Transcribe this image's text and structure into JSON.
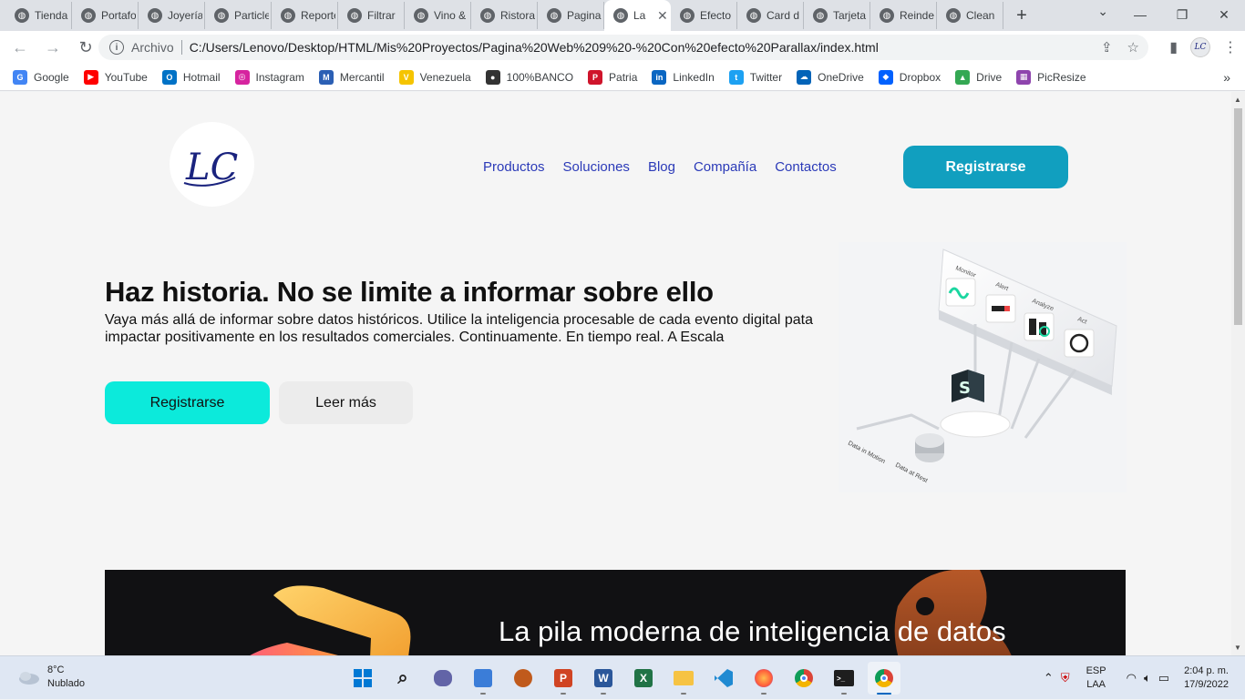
{
  "browser": {
    "tabs": [
      {
        "label": "Tienda",
        "active": false
      },
      {
        "label": "Portafolio",
        "active": false
      },
      {
        "label": "Joyería",
        "active": false
      },
      {
        "label": "Particles",
        "active": false
      },
      {
        "label": "Reportes",
        "active": false
      },
      {
        "label": "Filtrar",
        "active": false
      },
      {
        "label": "Vino &",
        "active": false
      },
      {
        "label": "Ristorante",
        "active": false
      },
      {
        "label": "Pagina",
        "active": false
      },
      {
        "label": "La",
        "active": true
      },
      {
        "label": "Efecto",
        "active": false
      },
      {
        "label": "Card d",
        "active": false
      },
      {
        "label": "Tarjeta",
        "active": false
      },
      {
        "label": "Reindeer",
        "active": false
      },
      {
        "label": "Clean",
        "active": false
      }
    ],
    "new_tab_label": "+",
    "address": {
      "scheme_label": "Archivo",
      "url": "C:/Users/Lenovo/Desktop/HTML/Mis%20Proyectos/Pagina%20Web%209%20-%20Con%20efecto%20Parallax/index.html"
    },
    "bookmarks": [
      {
        "label": "Google",
        "color": "#4285f4",
        "glyph": "G"
      },
      {
        "label": "YouTube",
        "color": "#ff0000",
        "glyph": "▶"
      },
      {
        "label": "Hotmail",
        "color": "#0072c6",
        "glyph": "O"
      },
      {
        "label": "Instagram",
        "color": "#d6249f",
        "glyph": "◎"
      },
      {
        "label": "Mercantil",
        "color": "#2b5fb4",
        "glyph": "M"
      },
      {
        "label": "Venezuela",
        "color": "#f5c400",
        "glyph": "V"
      },
      {
        "label": "100%BANCO",
        "color": "#333333",
        "glyph": "●"
      },
      {
        "label": "Patria",
        "color": "#cf142b",
        "glyph": "P"
      },
      {
        "label": "LinkedIn",
        "color": "#0a66c2",
        "glyph": "in"
      },
      {
        "label": "Twitter",
        "color": "#1da1f2",
        "glyph": "t"
      },
      {
        "label": "OneDrive",
        "color": "#0364b8",
        "glyph": "☁"
      },
      {
        "label": "Dropbox",
        "color": "#0061fe",
        "glyph": "◆"
      },
      {
        "label": "Drive",
        "color": "#34a853",
        "glyph": "▲"
      },
      {
        "label": "PicResize",
        "color": "#8e44ad",
        "glyph": "▦"
      }
    ],
    "bookmarks_more": "»"
  },
  "site": {
    "logo_text": "LC",
    "nav": [
      "Productos",
      "Soluciones",
      "Blog",
      "Compañía",
      "Contactos"
    ],
    "register_top": "Registrarse",
    "hero": {
      "title": "Haz historia. No se limite a informar sobre ello",
      "description": "Vaya más allá de informar sobre datos históricos. Utilice la inteligencia procesable de cada evento digital pata impactar positivamente en los resultados comerciales. Continuamente. En tiempo real. A Escala",
      "primary_button": "Registrarse",
      "secondary_button": "Leer más"
    },
    "hero_image_labels": {
      "monitor": "Monitor",
      "alert": "Alert",
      "analyze": "Analyze",
      "act": "Act",
      "data_in_motion": "Data in Motion",
      "data_at_rest": "Data at Rest"
    },
    "section2_title": "La pila moderna de inteligencia de datos"
  },
  "taskbar": {
    "weather_temp": "8°C",
    "weather_desc": "Nublado",
    "lang_line1": "ESP",
    "lang_line2": "LAA",
    "time": "2:04 p. m.",
    "date": "17/9/2022"
  },
  "colors": {
    "nav_link": "#2b3ab8",
    "register_top_bg": "#119fbf",
    "primary_bg": "#0ceadb",
    "secondary_bg": "#ececec",
    "dark_section_bg": "#111113"
  }
}
